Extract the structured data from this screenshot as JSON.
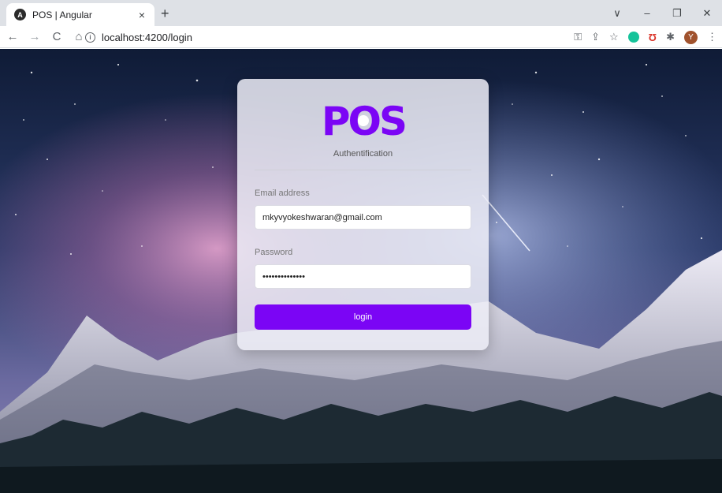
{
  "browser": {
    "tab_title": "POS | Angular",
    "tab_close_glyph": "×",
    "new_tab_glyph": "+",
    "url": "localhost:4200/login",
    "avatar_letter": "Y",
    "window_controls": [
      "∨",
      "–",
      "❐",
      "✕"
    ],
    "nav_icons": [
      "back-icon",
      "forward-icon",
      "reload-icon",
      "home-icon"
    ],
    "right_icons": [
      "key-icon",
      "share-icon",
      "star-icon",
      "grammarly-icon",
      "extension-red-icon",
      "puzzle-icon",
      "avatar",
      "menu-icon"
    ]
  },
  "login": {
    "logo_text": "POS",
    "caption": "Authentification",
    "email_label": "Email address",
    "email_value": "mkyvyokeshwaran@gmail.com",
    "password_label": "Password",
    "password_value": "••••••••••••••",
    "button_label": "login"
  },
  "colors": {
    "accent": "#7b05f5",
    "chrome_bg": "#dee1e6",
    "card_bg": "rgba(236,236,246,0.86)"
  }
}
